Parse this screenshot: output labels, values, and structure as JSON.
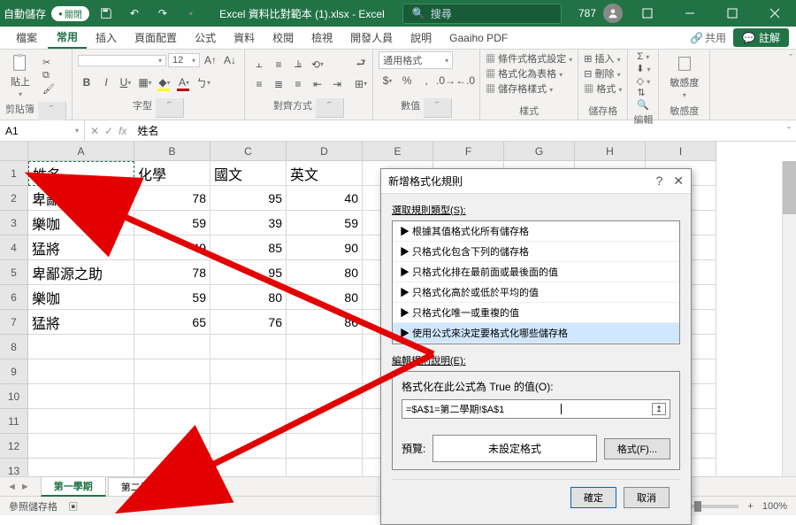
{
  "titlebar": {
    "autosave": "自動儲存",
    "autosave_state": "關閉",
    "doc_title": "Excel 資料比對範本 (1).xlsx - Excel",
    "search_placeholder": "搜尋",
    "user_label": "787"
  },
  "tabs": {
    "file": "檔案",
    "home": "常用",
    "insert": "插入",
    "page_layout": "頁面配置",
    "formulas": "公式",
    "data": "資料",
    "review": "校閱",
    "view": "檢視",
    "developer": "開發人員",
    "help": "說明",
    "addin": "Gaaiho PDF",
    "share": "共用",
    "comments": "註解"
  },
  "ribbon": {
    "clipboard": "剪貼簿",
    "paste": "貼上",
    "font": "字型",
    "font_size": "12",
    "alignment": "對齊方式",
    "number": "數值",
    "number_format": "通用格式",
    "styles": "樣式",
    "cond_fmt": "條件式格式設定",
    "as_table": "格式化為表格",
    "cell_styles": "儲存格樣式",
    "cells": "儲存格",
    "insert_c": "插入",
    "delete_c": "刪除",
    "format_c": "格式",
    "editing": "編輯",
    "sensitivity": "敏感度",
    "sens_label": "敏感度"
  },
  "formula_bar": {
    "name_box": "A1",
    "fx": "fx",
    "value": "姓名"
  },
  "columns": [
    "A",
    "B",
    "C",
    "D",
    "E",
    "F",
    "G",
    "H",
    "I"
  ],
  "header_row": [
    "姓名",
    "化學",
    "國文",
    "英文"
  ],
  "data_rows": [
    [
      "卑鄙源之助",
      "78",
      "95",
      "40"
    ],
    [
      "樂咖",
      "59",
      "39",
      "59"
    ],
    [
      "猛將",
      "49",
      "85",
      "90"
    ],
    [
      "卑鄙源之助",
      "78",
      "95",
      "80"
    ],
    [
      "樂咖",
      "59",
      "80",
      "80"
    ],
    [
      "猛將",
      "65",
      "76",
      "86"
    ]
  ],
  "sheets": {
    "s1": "第一學期",
    "s2": "第二學期"
  },
  "dialog": {
    "title": "新增格式化規則",
    "section1": "選取規則類型(S):",
    "rules": [
      "▶ 根據其值格式化所有儲存格",
      "▶ 只格式化包含下列的儲存格",
      "▶ 只格式化排在最前面或最後面的值",
      "▶ 只格式化高於或低於平均的值",
      "▶ 只格式化唯一或重複的值",
      "▶ 使用公式來決定要格式化哪些儲存格"
    ],
    "section2": "編輯規則說明(E):",
    "formula_label": "格式化在此公式為 True 的值(O):",
    "formula_value": "=$A$1=第二學期!$A$1",
    "preview_label": "預覽:",
    "preview_box": "未設定格式",
    "format_btn": "格式(F)...",
    "ok": "確定",
    "cancel": "取消"
  },
  "status": {
    "mode": "參照儲存格",
    "zoom": "100%"
  }
}
